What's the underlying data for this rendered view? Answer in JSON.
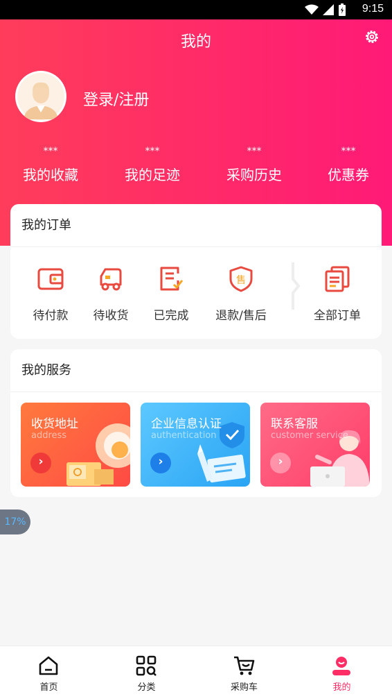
{
  "status_bar": {
    "time": "9:15"
  },
  "header": {
    "title": "我的"
  },
  "profile": {
    "login_label": "登录/注册"
  },
  "stats": [
    {
      "value": "***",
      "label": "我的收藏"
    },
    {
      "value": "***",
      "label": "我的足迹"
    },
    {
      "value": "***",
      "label": "采购历史"
    },
    {
      "value": "***",
      "label": "优惠券"
    }
  ],
  "orders": {
    "title": "我的订单",
    "items": [
      {
        "label": "待付款",
        "icon": "wallet-icon"
      },
      {
        "label": "待收货",
        "icon": "truck-icon"
      },
      {
        "label": "已完成",
        "icon": "completed-list-icon"
      },
      {
        "label": "退款/售后",
        "icon": "after-sale-shield-icon"
      },
      {
        "label": "全部订单",
        "icon": "all-orders-icon"
      }
    ]
  },
  "services": {
    "title": "我的服务",
    "items": [
      {
        "title": "收货地址",
        "subtitle": "address"
      },
      {
        "title": "企业信息认证",
        "subtitle": "authentication"
      },
      {
        "title": "联系客服",
        "subtitle": "customer service"
      }
    ]
  },
  "progress_badge": "17%",
  "tabbar": [
    {
      "label": "首页",
      "icon": "home-icon"
    },
    {
      "label": "分类",
      "icon": "category-icon"
    },
    {
      "label": "采购车",
      "icon": "cart-icon"
    },
    {
      "label": "我的",
      "icon": "profile-icon"
    }
  ],
  "colors": {
    "brand": "#ff2d66",
    "accent_red": "#e84a3f",
    "icon_red": "#f0504a"
  }
}
